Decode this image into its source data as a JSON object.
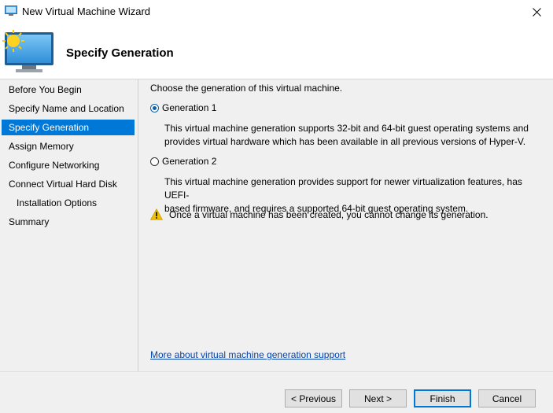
{
  "window": {
    "title": "New Virtual Machine Wizard"
  },
  "header": {
    "title": "Specify Generation"
  },
  "nav": {
    "items": [
      {
        "label": "Before You Begin"
      },
      {
        "label": "Specify Name and Location"
      },
      {
        "label": "Specify Generation",
        "selected": true
      },
      {
        "label": "Assign Memory"
      },
      {
        "label": "Configure Networking"
      },
      {
        "label": "Connect Virtual Hard Disk"
      },
      {
        "label": "Installation Options",
        "indent": true
      },
      {
        "label": "Summary"
      }
    ]
  },
  "main": {
    "prompt": "Choose the generation of this virtual machine.",
    "options": [
      {
        "label": "Generation 1",
        "checked": true,
        "description_line1": "This virtual machine generation supports 32-bit and 64-bit guest operating systems and",
        "description_line2": "provides virtual hardware which has been available in all previous versions of Hyper-V."
      },
      {
        "label": "Generation 2",
        "checked": false,
        "description_line1": "This virtual machine generation provides support for newer virtualization features, has UEFI-",
        "description_line2": "based firmware, and requires a supported 64-bit guest operating system."
      }
    ],
    "warning": "Once a virtual machine has been created, you cannot change its generation.",
    "more_link": "More about virtual machine generation support"
  },
  "buttons": {
    "previous": "< Previous",
    "next": "Next >",
    "finish": "Finish",
    "cancel": "Cancel"
  },
  "colors": {
    "selection": "#0078d7",
    "link": "#0645ad",
    "warning": "#f2c100"
  },
  "icons": {
    "app": "hyperv-monitor-icon",
    "close": "close-icon",
    "warning": "warning-icon"
  }
}
